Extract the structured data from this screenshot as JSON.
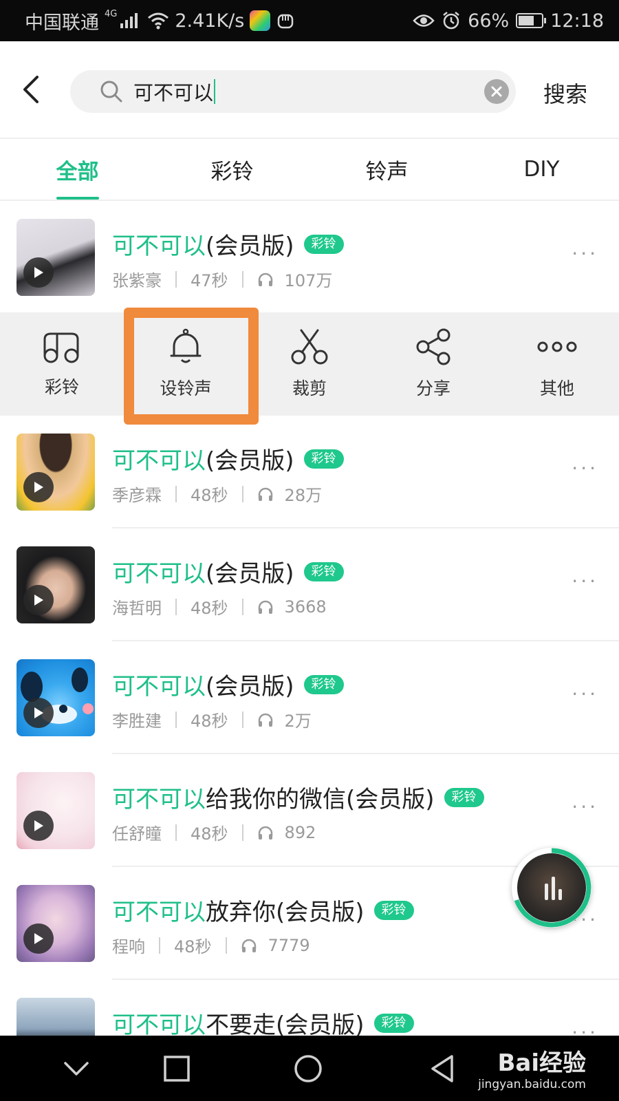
{
  "status_bar": {
    "carrier": "中国联通",
    "network": "4G",
    "speed": "2.41K/s",
    "battery": "66%",
    "time": "12:18"
  },
  "search": {
    "query": "可不可以",
    "submit_label": "搜索"
  },
  "tabs": [
    {
      "label": "全部",
      "active": true
    },
    {
      "label": "彩铃",
      "active": false
    },
    {
      "label": "铃声",
      "active": false
    },
    {
      "label": "DIY",
      "active": false
    }
  ],
  "results": [
    {
      "keyword": "可不可以",
      "suffix": "(会员版)",
      "badge": "彩铃",
      "artist": "张紫豪",
      "duration": "47秒",
      "plays": "107万"
    },
    {
      "keyword": "可不可以",
      "suffix": "(会员版)",
      "badge": "彩铃",
      "artist": "季彦霖",
      "duration": "48秒",
      "plays": "28万"
    },
    {
      "keyword": "可不可以",
      "suffix": "(会员版)",
      "badge": "彩铃",
      "artist": "海哲明",
      "duration": "48秒",
      "plays": "3668"
    },
    {
      "keyword": "可不可以",
      "suffix": "(会员版)",
      "badge": "彩铃",
      "artist": "李胜建",
      "duration": "48秒",
      "plays": "2万"
    },
    {
      "keyword": "可不可以",
      "suffix": "给我你的微信(会员版)",
      "badge": "彩铃",
      "artist": "任舒瞳",
      "duration": "48秒",
      "plays": "892"
    },
    {
      "keyword": "可不可以",
      "suffix": "放弃你(会员版)",
      "badge": "彩铃",
      "artist": "程响",
      "duration": "48秒",
      "plays": "7779"
    },
    {
      "keyword": "可不可以",
      "suffix": "不要走(会员版)",
      "badge": "彩铃"
    }
  ],
  "actions": [
    {
      "label": "彩铃",
      "icon": "music-note-icon"
    },
    {
      "label": "设铃声",
      "icon": "bell-icon"
    },
    {
      "label": "裁剪",
      "icon": "scissors-icon"
    },
    {
      "label": "分享",
      "icon": "share-icon"
    },
    {
      "label": "其他",
      "icon": "more-icon"
    }
  ],
  "watermark": {
    "brand": "Bai经验",
    "url": "jingyan.baidu.com"
  },
  "colors": {
    "accent": "#1fbf89",
    "highlight_border": "#f08a3c",
    "action_bar_bg": "#f0f0f0"
  }
}
